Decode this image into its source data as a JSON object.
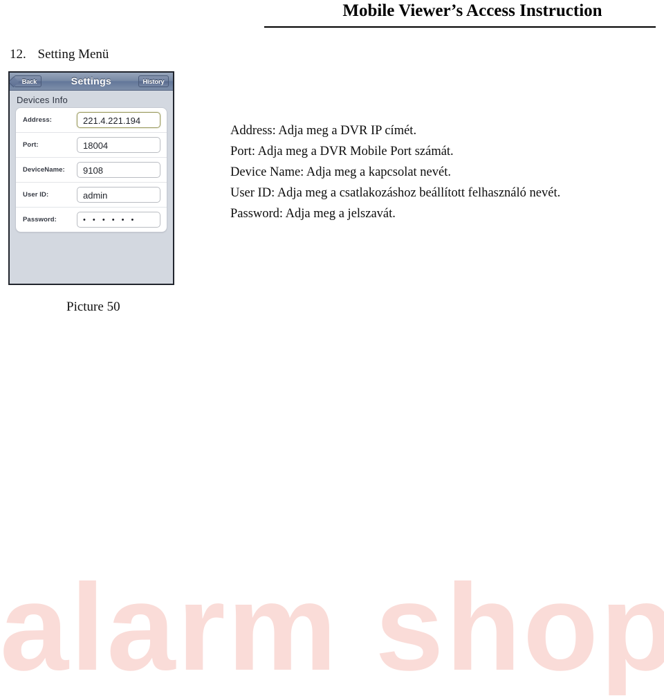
{
  "header": {
    "title": "Mobile Viewer’s Access Instruction"
  },
  "section": {
    "number": "12.",
    "title": "Setting Menü"
  },
  "phone": {
    "navbar": {
      "back_label": "Back",
      "title": "Settings",
      "history_label": "History"
    },
    "section_label": "Devices Info",
    "fields": [
      {
        "label": "Address:",
        "value": "221.4.221.194",
        "focused": true,
        "masked": false
      },
      {
        "label": "Port:",
        "value": "18004",
        "focused": false,
        "masked": false
      },
      {
        "label": "DeviceName:",
        "value": "9108",
        "focused": false,
        "masked": false
      },
      {
        "label": "User ID:",
        "value": "admin",
        "focused": false,
        "masked": false
      },
      {
        "label": "Password:",
        "value": "• • • • • •",
        "focused": false,
        "masked": true
      }
    ]
  },
  "descriptions": [
    "Address: Adja meg a DVR IP címét.",
    "Port: Adja meg a DVR Mobile Port számát.",
    "Device Name: Adja meg a kapcsolat nevét.",
    "User ID: Adja meg a csatlakozáshoz beállított felhasználó nevét.",
    "Password: Adja meg a jelszavát."
  ],
  "caption": "Picture 50",
  "watermark": {
    "text": "alarm shop",
    "color": "#fadcd8"
  }
}
